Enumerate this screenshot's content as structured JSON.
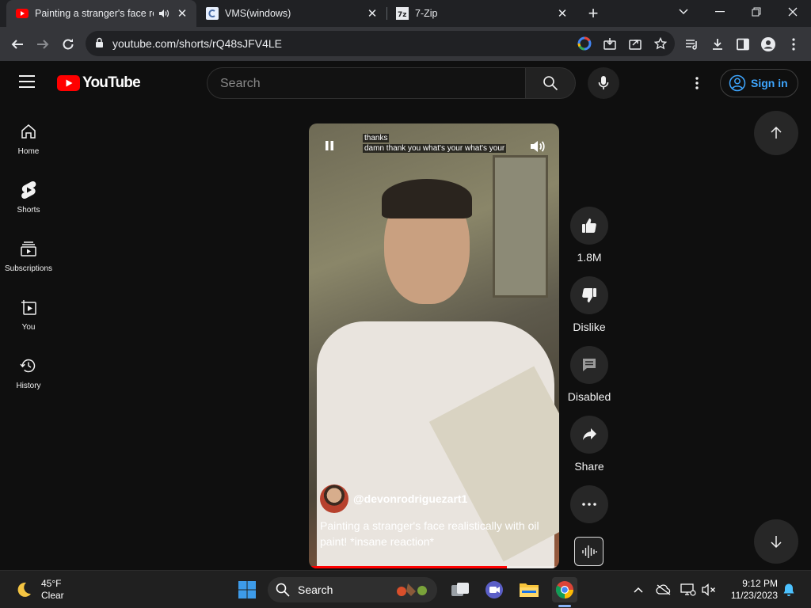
{
  "browser": {
    "tabs": [
      {
        "title": "Painting a stranger's face rea",
        "active": true
      },
      {
        "title": "VMS(windows)",
        "active": false
      },
      {
        "title": "7-Zip",
        "active": false
      }
    ],
    "url": "youtube.com/shorts/rQ48sJFV4LE"
  },
  "youtube": {
    "logo_text": "YouTube",
    "search_placeholder": "Search",
    "signin_label": "Sign in",
    "guide": [
      {
        "label": "Home",
        "icon": "home-icon"
      },
      {
        "label": "Shorts",
        "icon": "shorts-icon"
      },
      {
        "label": "Subscriptions",
        "icon": "subscriptions-icon"
      },
      {
        "label": "You",
        "icon": "you-icon"
      },
      {
        "label": "History",
        "icon": "history-icon"
      }
    ]
  },
  "short": {
    "captions": [
      "thanks",
      "damn thank you what's your what's your"
    ],
    "channel_handle": "@devonrodriguezart1",
    "title": "Painting a stranger's face realistically with oil paint! *insane reaction*",
    "progress_fraction": 0.79,
    "actions": {
      "likes": "1.8M",
      "dislike": "Dislike",
      "comments": "Disabled",
      "share": "Share"
    }
  },
  "taskbar": {
    "temperature": "45°F",
    "condition": "Clear",
    "search_label": "Search",
    "time": "9:12 PM",
    "date": "11/23/2023"
  },
  "colors": {
    "accent_blue": "#3ea6ff",
    "youtube_red": "#ff0000",
    "background": "#0f0f0f"
  }
}
